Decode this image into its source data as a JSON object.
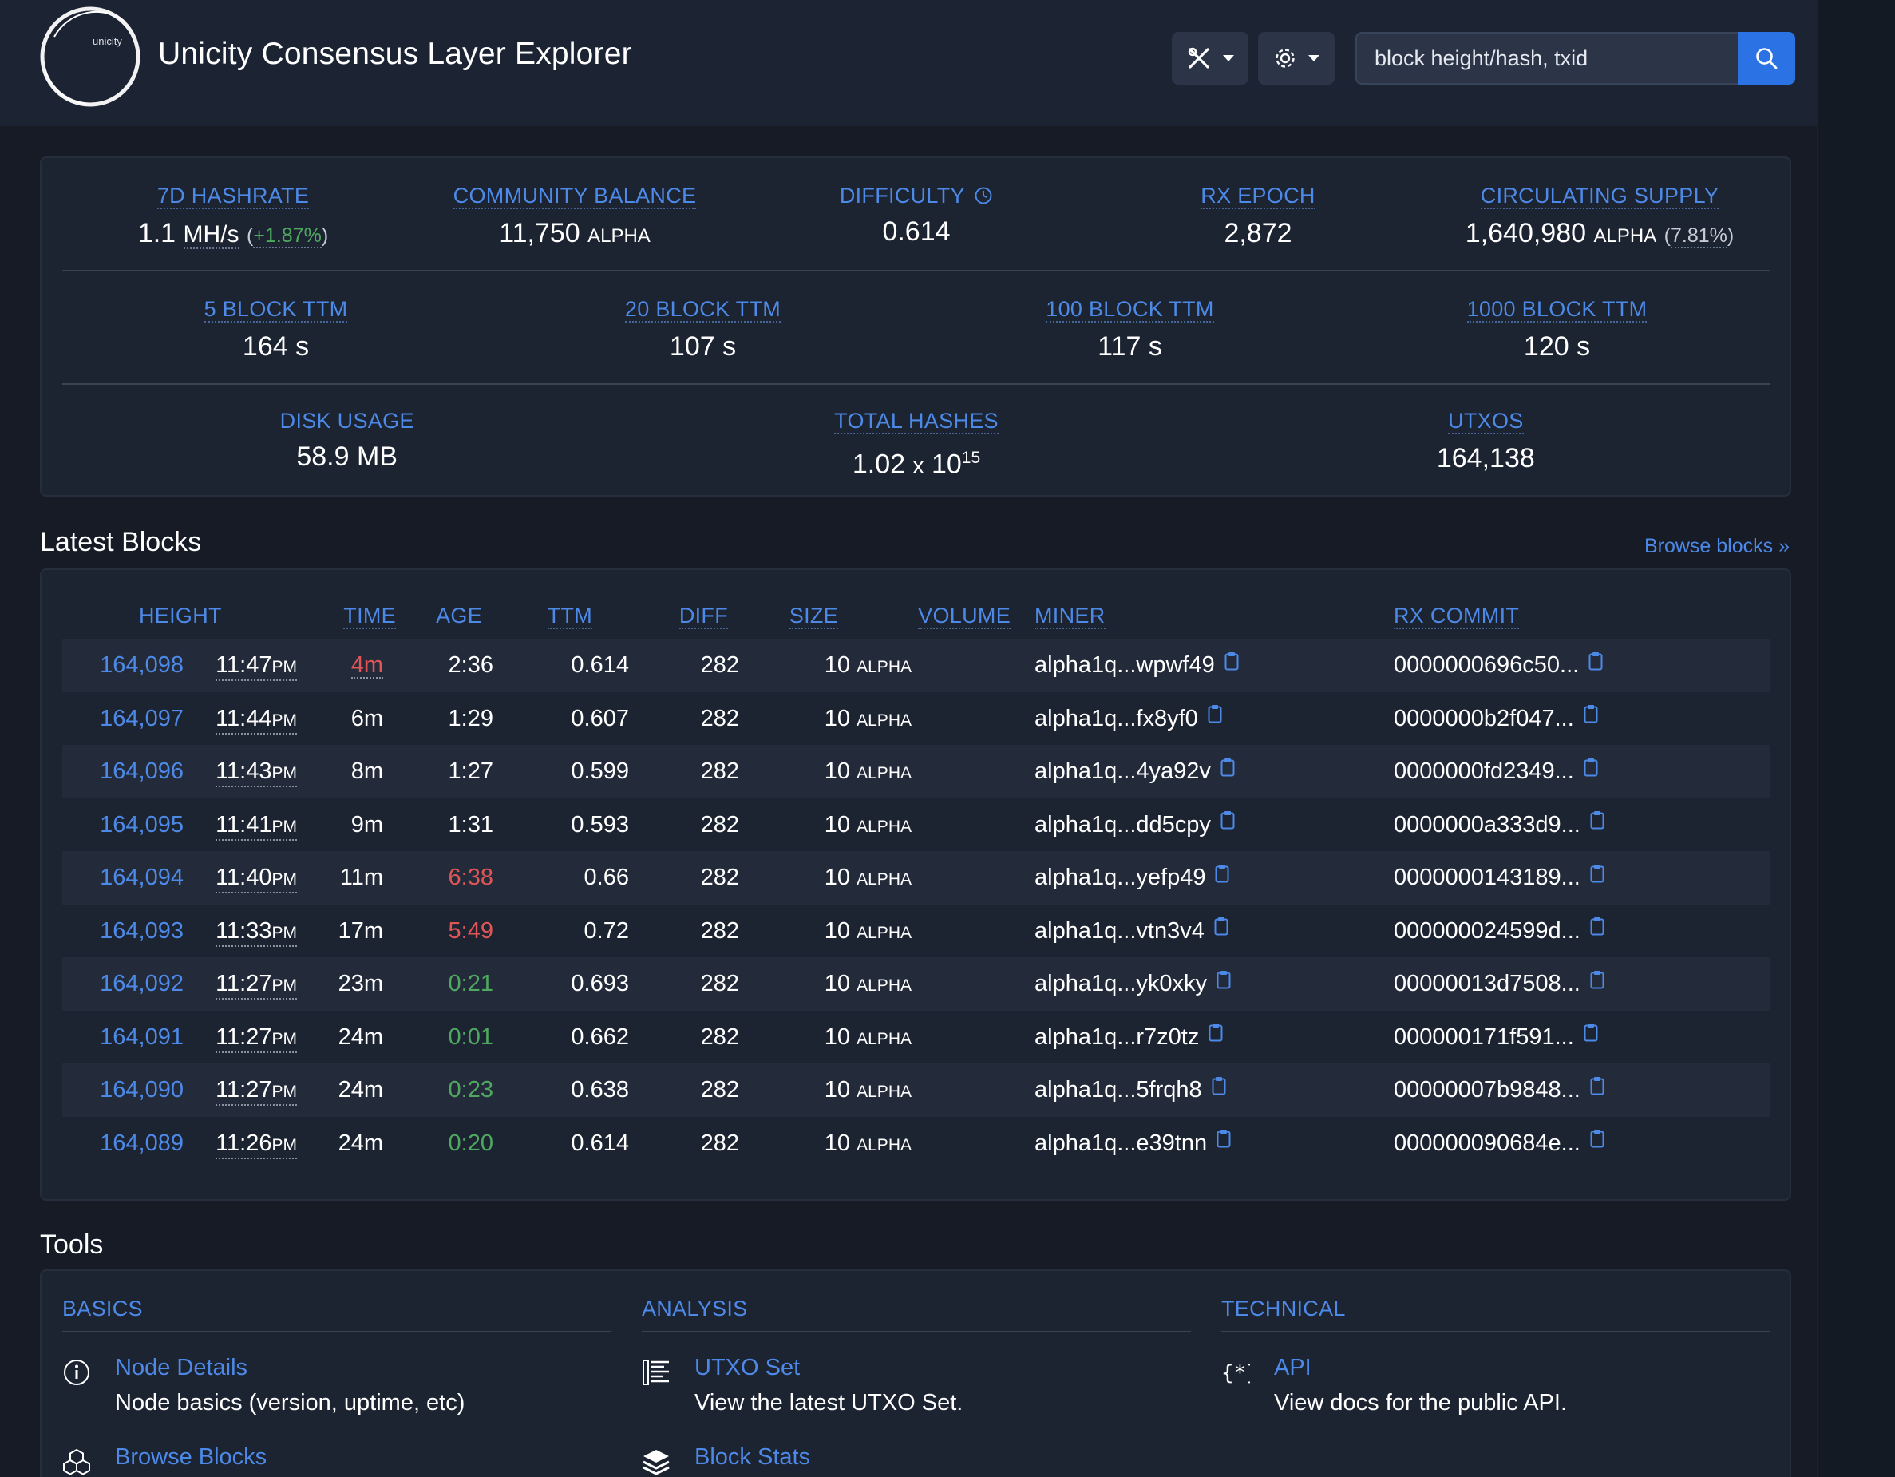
{
  "header": {
    "logo_text": "unicity",
    "title": "Unicity Consensus Layer Explorer",
    "search_placeholder": "block height/hash, txid"
  },
  "stats": {
    "row1": [
      {
        "label": "7D HASHRATE",
        "value": "1.1",
        "unit": "MH/s",
        "extra": "+1.87%"
      },
      {
        "label": "COMMUNITY BALANCE",
        "value": "11,750",
        "unit": "ALPHA"
      },
      {
        "label": "DIFFICULTY",
        "value": "0.614"
      },
      {
        "label": "RX EPOCH",
        "value": "2,872"
      },
      {
        "label": "CIRCULATING SUPPLY",
        "value": "1,640,980",
        "unit": "ALPHA",
        "extra": "7.81%"
      }
    ],
    "row2": [
      {
        "label": "5 BLOCK TTM",
        "value": "164 s"
      },
      {
        "label": "20 BLOCK TTM",
        "value": "107 s"
      },
      {
        "label": "100 BLOCK TTM",
        "value": "117 s"
      },
      {
        "label": "1000 BLOCK TTM",
        "value": "120 s"
      }
    ],
    "row3": [
      {
        "label": "DISK USAGE",
        "value": "58.9 MB"
      },
      {
        "label": "TOTAL HASHES",
        "value": "1.02",
        "times": "x",
        "base": "10",
        "exp": "15"
      },
      {
        "label": "UTXOS",
        "value": "164,138"
      }
    ]
  },
  "latest_blocks": {
    "title": "Latest Blocks",
    "browse_link": "Browse blocks »",
    "columns": {
      "height": "HEIGHT",
      "time": "TIME",
      "age": "AGE",
      "ttm": "TTM",
      "diff": "DIFF",
      "size": "SIZE",
      "volume": "VOLUME",
      "miner": "MINER",
      "rx_commit": "RX COMMIT"
    },
    "rows": [
      {
        "height": "164,098",
        "time": "11:47",
        "ampm": "PM",
        "age": "4m",
        "ttm": "2:36",
        "diff": "0.614",
        "size": "282",
        "volume": "10",
        "vol_unit": "ALPHA",
        "miner": "alpha1q...wpwf49",
        "rx": "0000000696c50..."
      },
      {
        "height": "164,097",
        "time": "11:44",
        "ampm": "PM",
        "age": "6m",
        "ttm": "1:29",
        "diff": "0.607",
        "size": "282",
        "volume": "10",
        "vol_unit": "ALPHA",
        "miner": "alpha1q...fx8yf0",
        "rx": "0000000b2f047..."
      },
      {
        "height": "164,096",
        "time": "11:43",
        "ampm": "PM",
        "age": "8m",
        "ttm": "1:27",
        "diff": "0.599",
        "size": "282",
        "volume": "10",
        "vol_unit": "ALPHA",
        "miner": "alpha1q...4ya92v",
        "rx": "0000000fd2349..."
      },
      {
        "height": "164,095",
        "time": "11:41",
        "ampm": "PM",
        "age": "9m",
        "ttm": "1:31",
        "diff": "0.593",
        "size": "282",
        "volume": "10",
        "vol_unit": "ALPHA",
        "miner": "alpha1q...dd5cpy",
        "rx": "0000000a333d9..."
      },
      {
        "height": "164,094",
        "time": "11:40",
        "ampm": "PM",
        "age": "11m",
        "ttm": "6:38",
        "diff": "0.66",
        "size": "282",
        "volume": "10",
        "vol_unit": "ALPHA",
        "miner": "alpha1q...yefp49",
        "rx": "0000000143189..."
      },
      {
        "height": "164,093",
        "time": "11:33",
        "ampm": "PM",
        "age": "17m",
        "ttm": "5:49",
        "diff": "0.72",
        "size": "282",
        "volume": "10",
        "vol_unit": "ALPHA",
        "miner": "alpha1q...vtn3v4",
        "rx": "000000024599d..."
      },
      {
        "height": "164,092",
        "time": "11:27",
        "ampm": "PM",
        "age": "23m",
        "ttm": "0:21",
        "diff": "0.693",
        "size": "282",
        "volume": "10",
        "vol_unit": "ALPHA",
        "miner": "alpha1q...yk0xky",
        "rx": "00000013d7508..."
      },
      {
        "height": "164,091",
        "time": "11:27",
        "ampm": "PM",
        "age": "24m",
        "ttm": "0:01",
        "diff": "0.662",
        "size": "282",
        "volume": "10",
        "vol_unit": "ALPHA",
        "miner": "alpha1q...r7z0tz",
        "rx": "000000171f591..."
      },
      {
        "height": "164,090",
        "time": "11:27",
        "ampm": "PM",
        "age": "24m",
        "ttm": "0:23",
        "diff": "0.638",
        "size": "282",
        "volume": "10",
        "vol_unit": "ALPHA",
        "miner": "alpha1q...5frqh8",
        "rx": "00000007b9848..."
      },
      {
        "height": "164,089",
        "time": "11:26",
        "ampm": "PM",
        "age": "24m",
        "ttm": "0:20",
        "diff": "0.614",
        "size": "282",
        "volume": "10",
        "vol_unit": "ALPHA",
        "miner": "alpha1q...e39tnn",
        "rx": "000000090684e..."
      }
    ]
  },
  "tools": {
    "title": "Tools",
    "basics": {
      "title": "BASICS",
      "items": [
        {
          "name": "Node Details",
          "desc": "Node basics (version, uptime, etc)",
          "icon": "info-icon"
        },
        {
          "name": "Browse Blocks",
          "icon": "cubes-icon"
        }
      ]
    },
    "analysis": {
      "title": "ANALYSIS",
      "items": [
        {
          "name": "UTXO Set",
          "desc": "View the latest UTXO Set.",
          "icon": "list-icon"
        },
        {
          "name": "Block Stats",
          "icon": "layers-icon"
        }
      ]
    },
    "technical": {
      "title": "TECHNICAL",
      "items": [
        {
          "name": "API",
          "desc": "View docs for the public API.",
          "icon": "braces-icon"
        }
      ]
    }
  },
  "colors": {
    "background": "#161b26",
    "navbar": "#1c2434",
    "accent": "#4d89e6",
    "search_button": "#2b73e5",
    "positive": "#4fa860",
    "negative": "#e05555"
  }
}
